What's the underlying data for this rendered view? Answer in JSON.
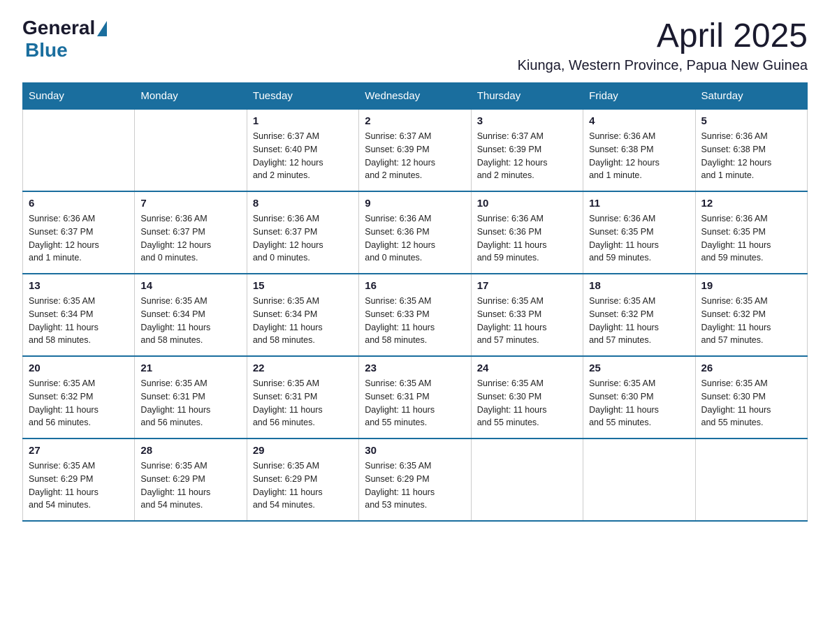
{
  "logo": {
    "general": "General",
    "blue": "Blue"
  },
  "title": {
    "month_year": "April 2025",
    "location": "Kiunga, Western Province, Papua New Guinea"
  },
  "days_of_week": [
    "Sunday",
    "Monday",
    "Tuesday",
    "Wednesday",
    "Thursday",
    "Friday",
    "Saturday"
  ],
  "weeks": [
    [
      {
        "day": "",
        "info": ""
      },
      {
        "day": "",
        "info": ""
      },
      {
        "day": "1",
        "info": "Sunrise: 6:37 AM\nSunset: 6:40 PM\nDaylight: 12 hours\nand 2 minutes."
      },
      {
        "day": "2",
        "info": "Sunrise: 6:37 AM\nSunset: 6:39 PM\nDaylight: 12 hours\nand 2 minutes."
      },
      {
        "day": "3",
        "info": "Sunrise: 6:37 AM\nSunset: 6:39 PM\nDaylight: 12 hours\nand 2 minutes."
      },
      {
        "day": "4",
        "info": "Sunrise: 6:36 AM\nSunset: 6:38 PM\nDaylight: 12 hours\nand 1 minute."
      },
      {
        "day": "5",
        "info": "Sunrise: 6:36 AM\nSunset: 6:38 PM\nDaylight: 12 hours\nand 1 minute."
      }
    ],
    [
      {
        "day": "6",
        "info": "Sunrise: 6:36 AM\nSunset: 6:37 PM\nDaylight: 12 hours\nand 1 minute."
      },
      {
        "day": "7",
        "info": "Sunrise: 6:36 AM\nSunset: 6:37 PM\nDaylight: 12 hours\nand 0 minutes."
      },
      {
        "day": "8",
        "info": "Sunrise: 6:36 AM\nSunset: 6:37 PM\nDaylight: 12 hours\nand 0 minutes."
      },
      {
        "day": "9",
        "info": "Sunrise: 6:36 AM\nSunset: 6:36 PM\nDaylight: 12 hours\nand 0 minutes."
      },
      {
        "day": "10",
        "info": "Sunrise: 6:36 AM\nSunset: 6:36 PM\nDaylight: 11 hours\nand 59 minutes."
      },
      {
        "day": "11",
        "info": "Sunrise: 6:36 AM\nSunset: 6:35 PM\nDaylight: 11 hours\nand 59 minutes."
      },
      {
        "day": "12",
        "info": "Sunrise: 6:36 AM\nSunset: 6:35 PM\nDaylight: 11 hours\nand 59 minutes."
      }
    ],
    [
      {
        "day": "13",
        "info": "Sunrise: 6:35 AM\nSunset: 6:34 PM\nDaylight: 11 hours\nand 58 minutes."
      },
      {
        "day": "14",
        "info": "Sunrise: 6:35 AM\nSunset: 6:34 PM\nDaylight: 11 hours\nand 58 minutes."
      },
      {
        "day": "15",
        "info": "Sunrise: 6:35 AM\nSunset: 6:34 PM\nDaylight: 11 hours\nand 58 minutes."
      },
      {
        "day": "16",
        "info": "Sunrise: 6:35 AM\nSunset: 6:33 PM\nDaylight: 11 hours\nand 58 minutes."
      },
      {
        "day": "17",
        "info": "Sunrise: 6:35 AM\nSunset: 6:33 PM\nDaylight: 11 hours\nand 57 minutes."
      },
      {
        "day": "18",
        "info": "Sunrise: 6:35 AM\nSunset: 6:32 PM\nDaylight: 11 hours\nand 57 minutes."
      },
      {
        "day": "19",
        "info": "Sunrise: 6:35 AM\nSunset: 6:32 PM\nDaylight: 11 hours\nand 57 minutes."
      }
    ],
    [
      {
        "day": "20",
        "info": "Sunrise: 6:35 AM\nSunset: 6:32 PM\nDaylight: 11 hours\nand 56 minutes."
      },
      {
        "day": "21",
        "info": "Sunrise: 6:35 AM\nSunset: 6:31 PM\nDaylight: 11 hours\nand 56 minutes."
      },
      {
        "day": "22",
        "info": "Sunrise: 6:35 AM\nSunset: 6:31 PM\nDaylight: 11 hours\nand 56 minutes."
      },
      {
        "day": "23",
        "info": "Sunrise: 6:35 AM\nSunset: 6:31 PM\nDaylight: 11 hours\nand 55 minutes."
      },
      {
        "day": "24",
        "info": "Sunrise: 6:35 AM\nSunset: 6:30 PM\nDaylight: 11 hours\nand 55 minutes."
      },
      {
        "day": "25",
        "info": "Sunrise: 6:35 AM\nSunset: 6:30 PM\nDaylight: 11 hours\nand 55 minutes."
      },
      {
        "day": "26",
        "info": "Sunrise: 6:35 AM\nSunset: 6:30 PM\nDaylight: 11 hours\nand 55 minutes."
      }
    ],
    [
      {
        "day": "27",
        "info": "Sunrise: 6:35 AM\nSunset: 6:29 PM\nDaylight: 11 hours\nand 54 minutes."
      },
      {
        "day": "28",
        "info": "Sunrise: 6:35 AM\nSunset: 6:29 PM\nDaylight: 11 hours\nand 54 minutes."
      },
      {
        "day": "29",
        "info": "Sunrise: 6:35 AM\nSunset: 6:29 PM\nDaylight: 11 hours\nand 54 minutes."
      },
      {
        "day": "30",
        "info": "Sunrise: 6:35 AM\nSunset: 6:29 PM\nDaylight: 11 hours\nand 53 minutes."
      },
      {
        "day": "",
        "info": ""
      },
      {
        "day": "",
        "info": ""
      },
      {
        "day": "",
        "info": ""
      }
    ]
  ]
}
